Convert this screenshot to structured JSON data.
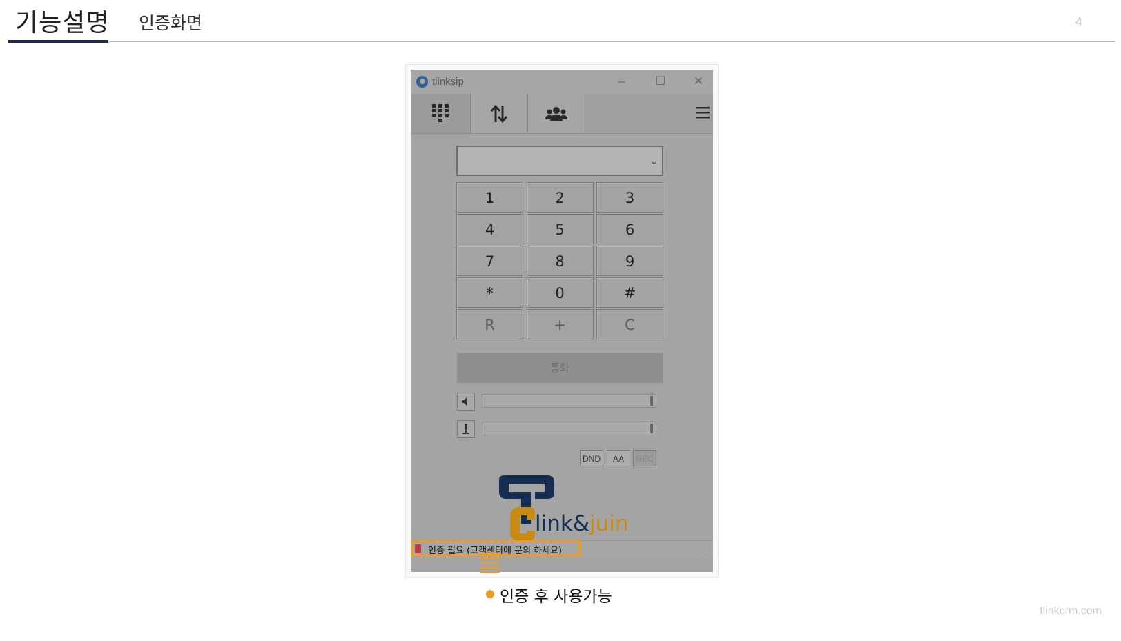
{
  "slide": {
    "title": "기능설명",
    "subtitle": "인증화면",
    "page_number": "4",
    "footer_brand": "tlinkcrm.com"
  },
  "app": {
    "window_title": "tlinksip",
    "tabs": [
      {
        "name": "dialpad",
        "icon": "dialpad-icon"
      },
      {
        "name": "transfer",
        "icon": "transfer-arrows-icon"
      },
      {
        "name": "contacts",
        "icon": "contacts-group-icon"
      }
    ],
    "menu_icon": "hamburger-menu-icon",
    "number_input": {
      "value": ""
    },
    "keypad": [
      [
        "1",
        "2",
        "3"
      ],
      [
        "4",
        "5",
        "6"
      ],
      [
        "7",
        "8",
        "9"
      ],
      [
        "*",
        "0",
        "#"
      ],
      [
        "R",
        "+",
        "C"
      ]
    ],
    "call_button_label": "통화",
    "speaker_volume": 1.0,
    "mic_volume": 1.0,
    "buttons": {
      "dnd": "DND",
      "aa": "AA",
      "rec": "REC"
    },
    "logo": {
      "part1": "link&",
      "part2": "juin"
    },
    "status_text": "인증 필요 (고객센터에 문의 하세요)"
  },
  "callout": {
    "text": "인증 후 사용가능"
  },
  "colors": {
    "accent_bar": "#1c2a48",
    "callout_orange": "#f29b1e",
    "logo_navy": "#152d52",
    "logo_gold": "#c98a12"
  }
}
